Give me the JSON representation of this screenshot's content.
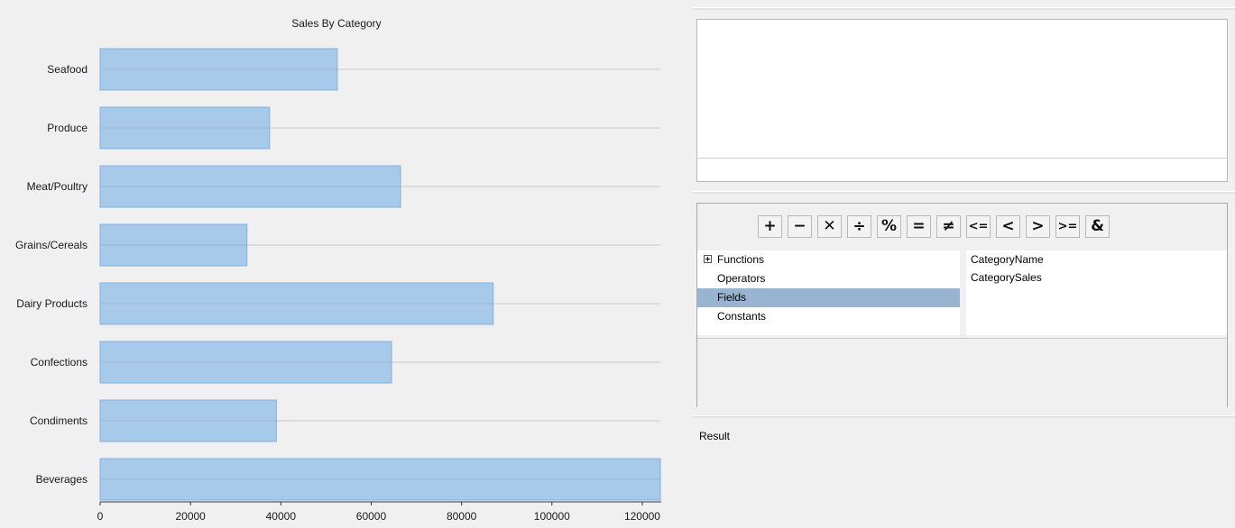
{
  "chart_data": {
    "type": "bar",
    "orientation": "horizontal",
    "title": "Sales By Category",
    "categories": [
      "Seafood",
      "Produce",
      "Meat/Poultry",
      "Grains/Cereals",
      "Dairy Products",
      "Confections",
      "Condiments",
      "Beverages"
    ],
    "values": [
      52500,
      37500,
      66500,
      32500,
      87000,
      64500,
      39000,
      124000
    ],
    "xlim": [
      0,
      124000
    ],
    "xticks": [
      0,
      20000,
      40000,
      60000,
      80000,
      100000,
      120000
    ],
    "grid": false,
    "bar_color": "#a8caea",
    "bar_border": "#7fb0e0"
  },
  "operators": [
    {
      "name": "plus",
      "symbol": "+"
    },
    {
      "name": "minus",
      "symbol": "−"
    },
    {
      "name": "multiply",
      "symbol": "✕"
    },
    {
      "name": "divide",
      "symbol": "÷"
    },
    {
      "name": "modulo",
      "symbol": "%"
    },
    {
      "name": "equals",
      "symbol": "="
    },
    {
      "name": "not-equals",
      "symbol": "≠"
    },
    {
      "name": "less-or-equal",
      "symbol": "<="
    },
    {
      "name": "less-than",
      "symbol": "<"
    },
    {
      "name": "greater-than",
      "symbol": ">"
    },
    {
      "name": "greater-or-equal",
      "symbol": ">="
    },
    {
      "name": "ampersand",
      "symbol": "&"
    }
  ],
  "categories_list": [
    {
      "label": "Functions",
      "expandable": true,
      "selected": false
    },
    {
      "label": "Operators",
      "expandable": false,
      "selected": false
    },
    {
      "label": "Fields",
      "expandable": false,
      "selected": true
    },
    {
      "label": "Constants",
      "expandable": false,
      "selected": false
    }
  ],
  "fields": [
    "CategoryName",
    "CategorySales"
  ],
  "result_label": "Result"
}
